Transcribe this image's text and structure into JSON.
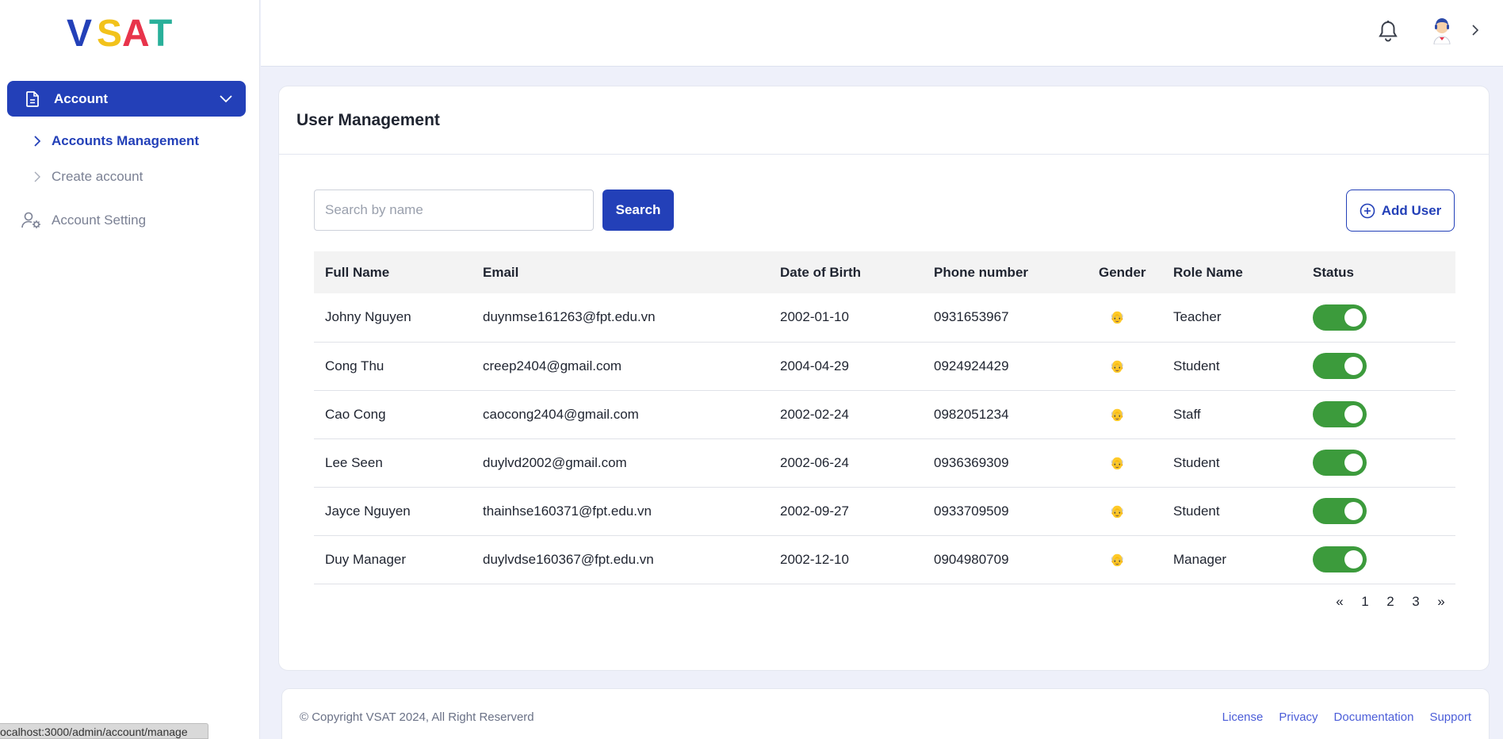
{
  "brand": {
    "name": "VSAT",
    "colors": [
      "#2340b8",
      "#f2c21b",
      "#e8344b",
      "#29b09a"
    ]
  },
  "sidebar": {
    "account": {
      "label": "Account",
      "icon": "document-icon",
      "chevron": "chevron-down-icon"
    },
    "sub_items": [
      {
        "label": "Accounts Management",
        "active": true
      },
      {
        "label": "Create account",
        "active": false
      }
    ],
    "setting": {
      "label": "Account Setting",
      "icon": "user-gear-icon"
    }
  },
  "topbar": {
    "notification_icon": "bell-icon",
    "avatar_icon": "avatar-icon",
    "chevron": "chevron-right-icon"
  },
  "main": {
    "title": "User Management",
    "search": {
      "placeholder": "Search by name",
      "value": "",
      "button_label": "Search"
    },
    "add_button_label": "Add User",
    "table": {
      "headers": [
        "Full Name",
        "Email",
        "Date of Birth",
        "Phone number",
        "Gender",
        "Role Name",
        "Status"
      ],
      "rows": [
        {
          "name": "Johny Nguyen",
          "email": "duynmse161263@fpt.edu.vn",
          "dob": "2002-01-10",
          "phone": "0931653967",
          "gender": "👴",
          "role": "Teacher",
          "status": true
        },
        {
          "name": "Cong Thu",
          "email": "creep2404@gmail.com",
          "dob": "2004-04-29",
          "phone": "0924924429",
          "gender": "👴",
          "role": "Student",
          "status": true
        },
        {
          "name": "Cao Cong",
          "email": "caocong2404@gmail.com",
          "dob": "2002-02-24",
          "phone": "0982051234",
          "gender": "👴",
          "role": "Staff",
          "status": true
        },
        {
          "name": "Lee Seen",
          "email": "duylvd2002@gmail.com",
          "dob": "2002-06-24",
          "phone": "0936369309",
          "gender": "👴",
          "role": "Student",
          "status": true
        },
        {
          "name": "Jayce Nguyen",
          "email": "thainhse160371@fpt.edu.vn",
          "dob": "2002-09-27",
          "phone": "0933709509",
          "gender": "👴",
          "role": "Student",
          "status": true
        },
        {
          "name": "Duy Manager",
          "email": "duylvdse160367@fpt.edu.vn",
          "dob": "2002-12-10",
          "phone": "0904980709",
          "gender": "👴",
          "role": "Manager",
          "status": true
        }
      ]
    },
    "pagination": {
      "prev": "«",
      "pages": [
        "1",
        "2",
        "3"
      ],
      "next": "»"
    }
  },
  "footer": {
    "copyright": "© Copyright VSAT 2024, All Right Reserverd",
    "links": [
      "License",
      "Privacy",
      "Documentation",
      "Support"
    ]
  },
  "status_url": "ocalhost:3000/admin/account/manage",
  "toggle_color": "#3c9b3c"
}
